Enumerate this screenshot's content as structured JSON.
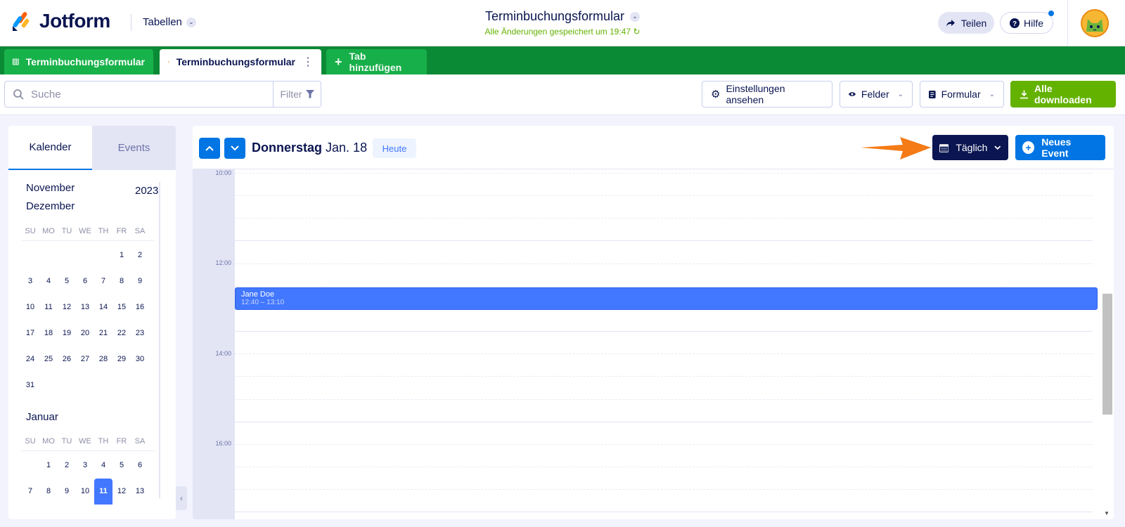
{
  "header": {
    "brand": "Jotform",
    "tabellen_label": "Tabellen",
    "form_title": "Terminbuchungsformular",
    "saved_status": "Alle Änderungen gespeichert um 19:47",
    "share_label": "Teilen",
    "help_label": "Hilfe"
  },
  "tabs": [
    {
      "label": "Terminbuchungsformular",
      "icon": "table-icon"
    },
    {
      "label": "Terminbuchungsformular",
      "icon": "calendar-icon"
    },
    {
      "label": "Tab hinzufügen",
      "icon": "plus-icon"
    }
  ],
  "toolbar": {
    "search_placeholder": "Suche",
    "filter_label": "Filter",
    "settings_label": "Einstellungen ansehen",
    "fields_label": "Felder",
    "form_label": "Formular",
    "download_label": "Alle downloaden"
  },
  "sidebar": {
    "tab_calendar": "Kalender",
    "tab_events": "Events",
    "year": "2023",
    "weekdays": [
      "SU",
      "MO",
      "TU",
      "WE",
      "TH",
      "FR",
      "SA"
    ],
    "months": [
      {
        "name": "November"
      },
      {
        "name": "Dezember",
        "days": [
          "",
          "",
          "",
          "",
          "",
          "1",
          "2",
          "3",
          "4",
          "5",
          "6",
          "7",
          "8",
          "9",
          "10",
          "11",
          "12",
          "13",
          "14",
          "15",
          "16",
          "17",
          "18",
          "19",
          "20",
          "21",
          "22",
          "23",
          "24",
          "25",
          "26",
          "27",
          "28",
          "29",
          "30",
          "31"
        ]
      },
      {
        "name": "Januar",
        "days": [
          "",
          "1",
          "2",
          "3",
          "4",
          "5",
          "6",
          "7",
          "8",
          "9",
          "10",
          "11",
          "12",
          "13"
        ],
        "selected": "11"
      }
    ]
  },
  "calendar": {
    "weekday": "Donnerstag",
    "date": "Jan. 18",
    "today_label": "Heute",
    "view_label": "Täglich",
    "new_event_label": "Neues Event",
    "time_labels": [
      "10:00",
      "12:00",
      "14:00",
      "16:00"
    ],
    "event": {
      "name": "Jane Doe",
      "time": "12:40 – 13:10"
    }
  },
  "colors": {
    "brand_green": "#0b8a35",
    "accent_blue": "#0075e3",
    "event_blue": "#4277ff",
    "download_green": "#64b200",
    "arrow_orange": "#f47b16"
  }
}
